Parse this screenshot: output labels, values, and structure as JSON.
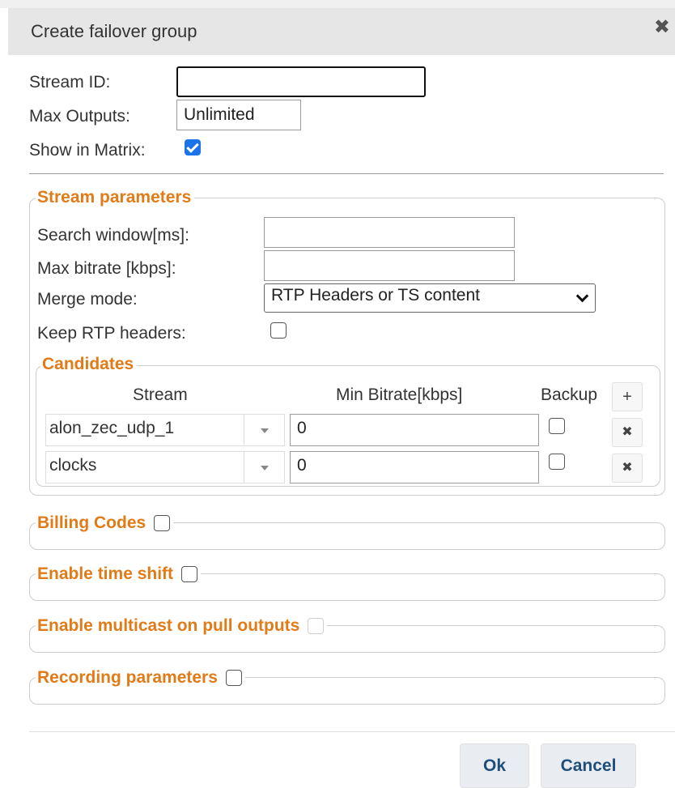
{
  "dialog": {
    "title": "Create failover group",
    "close_glyph": "✖"
  },
  "general": {
    "stream_id_label": "Stream ID:",
    "stream_id_value": "",
    "max_outputs_label": "Max Outputs:",
    "max_outputs_value": "Unlimited",
    "show_in_matrix_label": "Show in Matrix:",
    "show_in_matrix_checked": true
  },
  "stream_parameters": {
    "legend": "Stream parameters",
    "search_window_label": "Search window[ms]:",
    "search_window_value": "",
    "max_bitrate_label": "Max bitrate [kbps]:",
    "max_bitrate_value": "",
    "merge_mode_label": "Merge mode:",
    "merge_mode_value": "RTP Headers or TS content",
    "keep_rtp_label": "Keep RTP headers:",
    "keep_rtp_checked": false
  },
  "candidates": {
    "legend": "Candidates",
    "columns": [
      "Stream",
      "Min Bitrate[kbps]",
      "Backup"
    ],
    "add_glyph": "+",
    "remove_glyph": "✖",
    "rows": [
      {
        "stream": "alon_zec_udp_1",
        "min_bitrate": "0",
        "backup": false
      },
      {
        "stream": "clocks",
        "min_bitrate": "0",
        "backup": false
      }
    ]
  },
  "sections": [
    {
      "legend": "Billing Codes",
      "checked": false,
      "disabled": false
    },
    {
      "legend": "Enable time shift",
      "checked": false,
      "disabled": false
    },
    {
      "legend": "Enable multicast on pull outputs",
      "checked": false,
      "disabled": true
    },
    {
      "legend": "Recording parameters",
      "checked": false,
      "disabled": false
    }
  ],
  "buttons": {
    "ok": "Ok",
    "cancel": "Cancel"
  },
  "colors": {
    "legend_orange": "#e07b17",
    "checkbox_blue": "#1a73e8",
    "header_gray": "#e6e6e6",
    "button_text": "#1f4e7a"
  }
}
